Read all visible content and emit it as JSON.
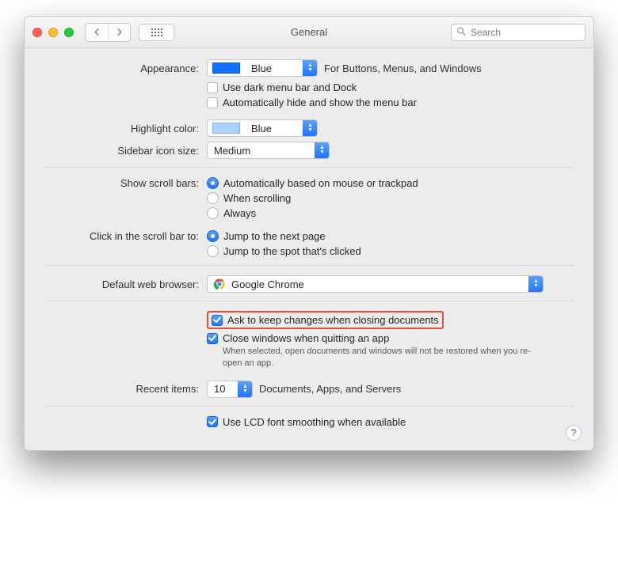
{
  "window": {
    "title": "General",
    "search_placeholder": "Search"
  },
  "labels": {
    "appearance": "Appearance:",
    "highlight": "Highlight color:",
    "sidebar": "Sidebar icon size:",
    "scrollbars": "Show scroll bars:",
    "scrollclick": "Click in the scroll bar to:",
    "browser": "Default web browser:",
    "recent": "Recent items:"
  },
  "appearance": {
    "value": "Blue",
    "hint": "For Buttons, Menus, and Windows",
    "dark_menu": "Use dark menu bar and Dock",
    "auto_hide": "Automatically hide and show the menu bar"
  },
  "highlight": {
    "value": "Blue"
  },
  "sidebar": {
    "value": "Medium"
  },
  "scrollbars": {
    "auto": "Automatically based on mouse or trackpad",
    "when": "When scrolling",
    "always": "Always"
  },
  "scrollclick": {
    "nextpage": "Jump to the next page",
    "spot": "Jump to the spot that's clicked"
  },
  "browser": {
    "value": "Google Chrome"
  },
  "documents": {
    "ask_keep": "Ask to keep changes when closing documents",
    "close_windows": "Close windows when quitting an app",
    "note": "When selected, open documents and windows will not be restored when you re-open an app."
  },
  "recent": {
    "value": "10",
    "suffix": "Documents, Apps, and Servers"
  },
  "font_smoothing": "Use LCD font smoothing when available",
  "help": "?"
}
